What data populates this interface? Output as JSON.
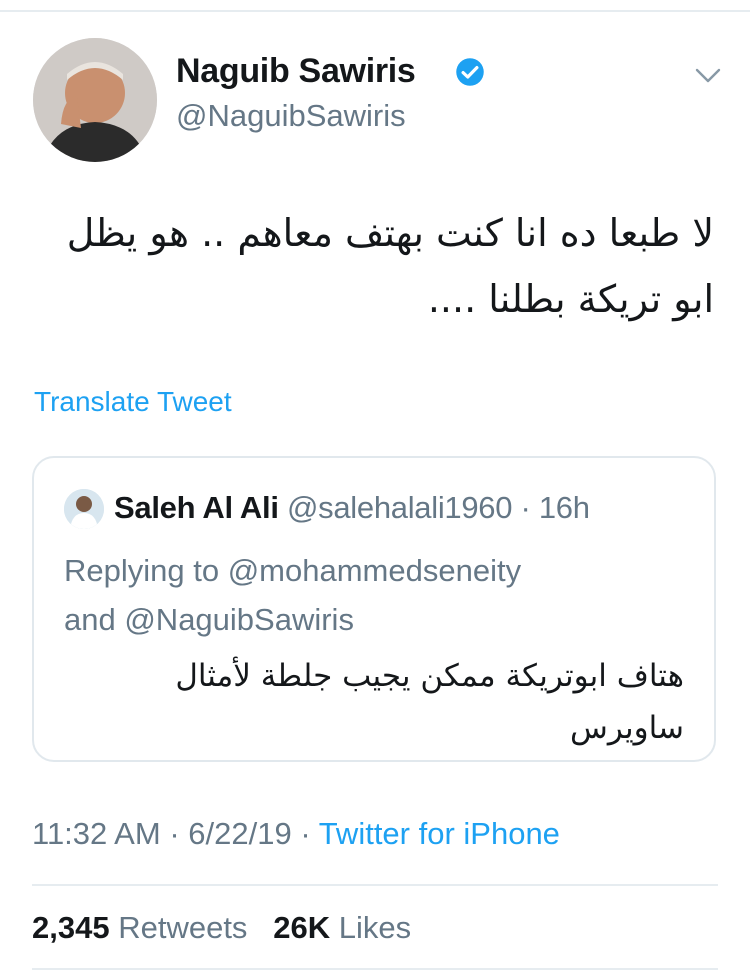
{
  "tweet": {
    "author": {
      "name": "Naguib Sawiris",
      "handle": "@NaguibSawiris"
    },
    "text_line1": "لا طبعا ده انا كنت بهتف معاهم .. هو يظل",
    "text_line2": "ابو تريكة بطلنا ....",
    "translate_label": "Translate Tweet",
    "time": "11:32 AM",
    "date": "6/22/19",
    "source": "Twitter for iPhone",
    "retweets_count": "2,345",
    "retweets_label": "Retweets",
    "likes_count": "26K",
    "likes_label": "Likes"
  },
  "quoted": {
    "name": "Saleh Al Ali",
    "handle": "@salehalali1960",
    "time": "16h",
    "replying_line1": "Replying to @mohammedseneity",
    "replying_line2": "and @NaguibSawiris",
    "text_line1": "هتاف ابوتريكة ممكن يجيب جلطة لأمثال",
    "text_line2": "ساويرس"
  },
  "colors": {
    "accent": "#1da1f2",
    "muted": "#657786",
    "text": "#14171a",
    "border": "#e1e8ed"
  },
  "icons": [
    "verified-badge-icon",
    "chevron-down-icon"
  ]
}
